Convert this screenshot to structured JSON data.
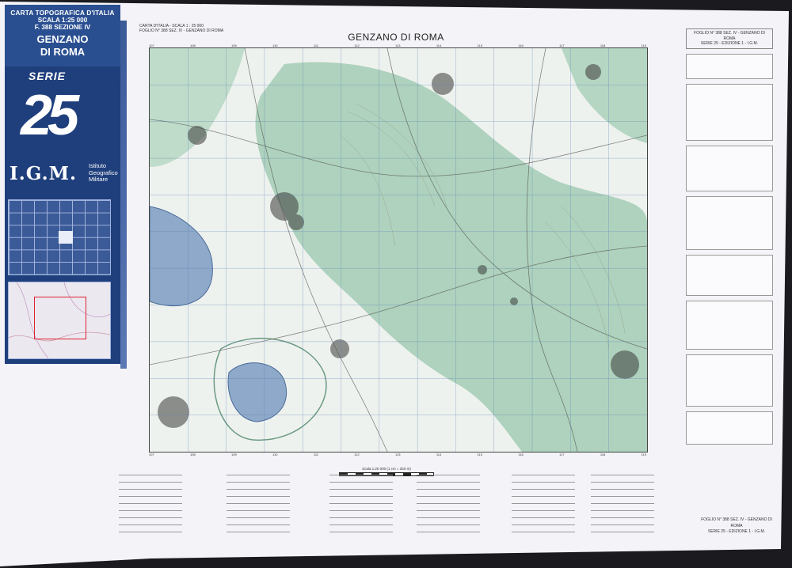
{
  "cover": {
    "line1": "CARTA TOPOGRAFICA D'ITALIA",
    "line2": "SCALA 1:25 000",
    "line3": "F. 388 SEZIONE IV",
    "title_1": "GENZANO",
    "title_2": "DI ROMA",
    "serie_label": "SERIE",
    "serie_number": "25",
    "publisher_abbr": "I.G.M.",
    "publisher_1": "Istituto",
    "publisher_2": "Geografico",
    "publisher_3": "Militare"
  },
  "header": {
    "left_1": "CARTA D'ITALIA - SCALA 1 : 25 000",
    "left_2": "FOGLIO N° 388 SEZ. IV - GENZANO DI ROMA",
    "map_title": "GENZANO DI ROMA"
  },
  "map": {
    "coords": [
      "107",
      "108",
      "109",
      "110",
      "111",
      "112",
      "113",
      "114",
      "115",
      "116",
      "117",
      "118",
      "119"
    ],
    "colors": {
      "forest": "#a6ceb7",
      "water": "#8ea9c9",
      "paper": "#eef2ee",
      "grid": "#5a7fb7",
      "urban": "#3a3a3a"
    }
  },
  "scale": {
    "label": "Scala 1:25 000 (1 cm = 250 m)"
  },
  "legend": {
    "right_header_1": "FOGLIO N° 388 SEZ. IV - GENZANO DI ROMA",
    "right_header_2": "SERIE 25 - EDIZIONE 1 - I.G.M."
  },
  "footer": {
    "line_1": "FOGLIO N° 388 SEZ. IV - GENZANO DI ROMA",
    "line_2": "SERIE 25 - EDIZIONE 1 - I.G.M."
  }
}
